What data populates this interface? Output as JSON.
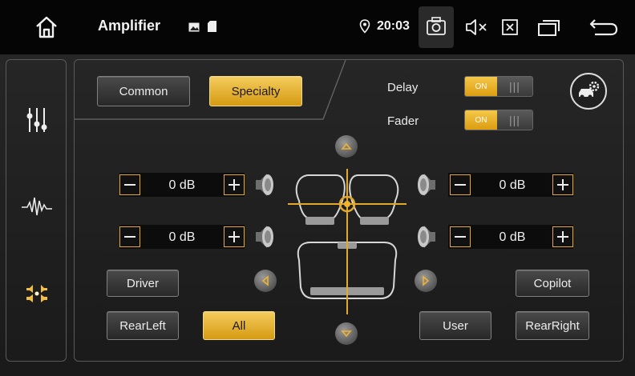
{
  "statusbar": {
    "title": "Amplifier",
    "time": "20:03"
  },
  "tabs": {
    "common": "Common",
    "specialty": "Specialty"
  },
  "switches": {
    "delay_label": "Delay",
    "delay_state": "ON",
    "fader_label": "Fader",
    "fader_state": "ON"
  },
  "levels": {
    "front_left": "0 dB",
    "front_right": "0 dB",
    "rear_left": "0 dB",
    "rear_right": "0 dB"
  },
  "presets": {
    "driver": "Driver",
    "copilot": "Copilot",
    "rear_left": "RearLeft",
    "all": "All",
    "user": "User",
    "rear_right": "RearRight"
  },
  "colors": {
    "accent": "#e4a92a",
    "active_button": "#f0bf3f"
  },
  "icons": {
    "home": "home-icon",
    "image": "image-icon",
    "sd_card": "sd-card-icon",
    "location": "location-pin-icon",
    "screenshot": "camera-icon",
    "mute": "volume-mute-icon",
    "close": "close-box-icon",
    "windows": "recent-apps-icon",
    "back": "back-icon",
    "equalizer": "equalizer-sliders-icon",
    "waveform": "waveform-icon",
    "sound_field": "sound-field-icon",
    "car_settings": "car-settings-icon",
    "speaker": "speaker-icon"
  }
}
